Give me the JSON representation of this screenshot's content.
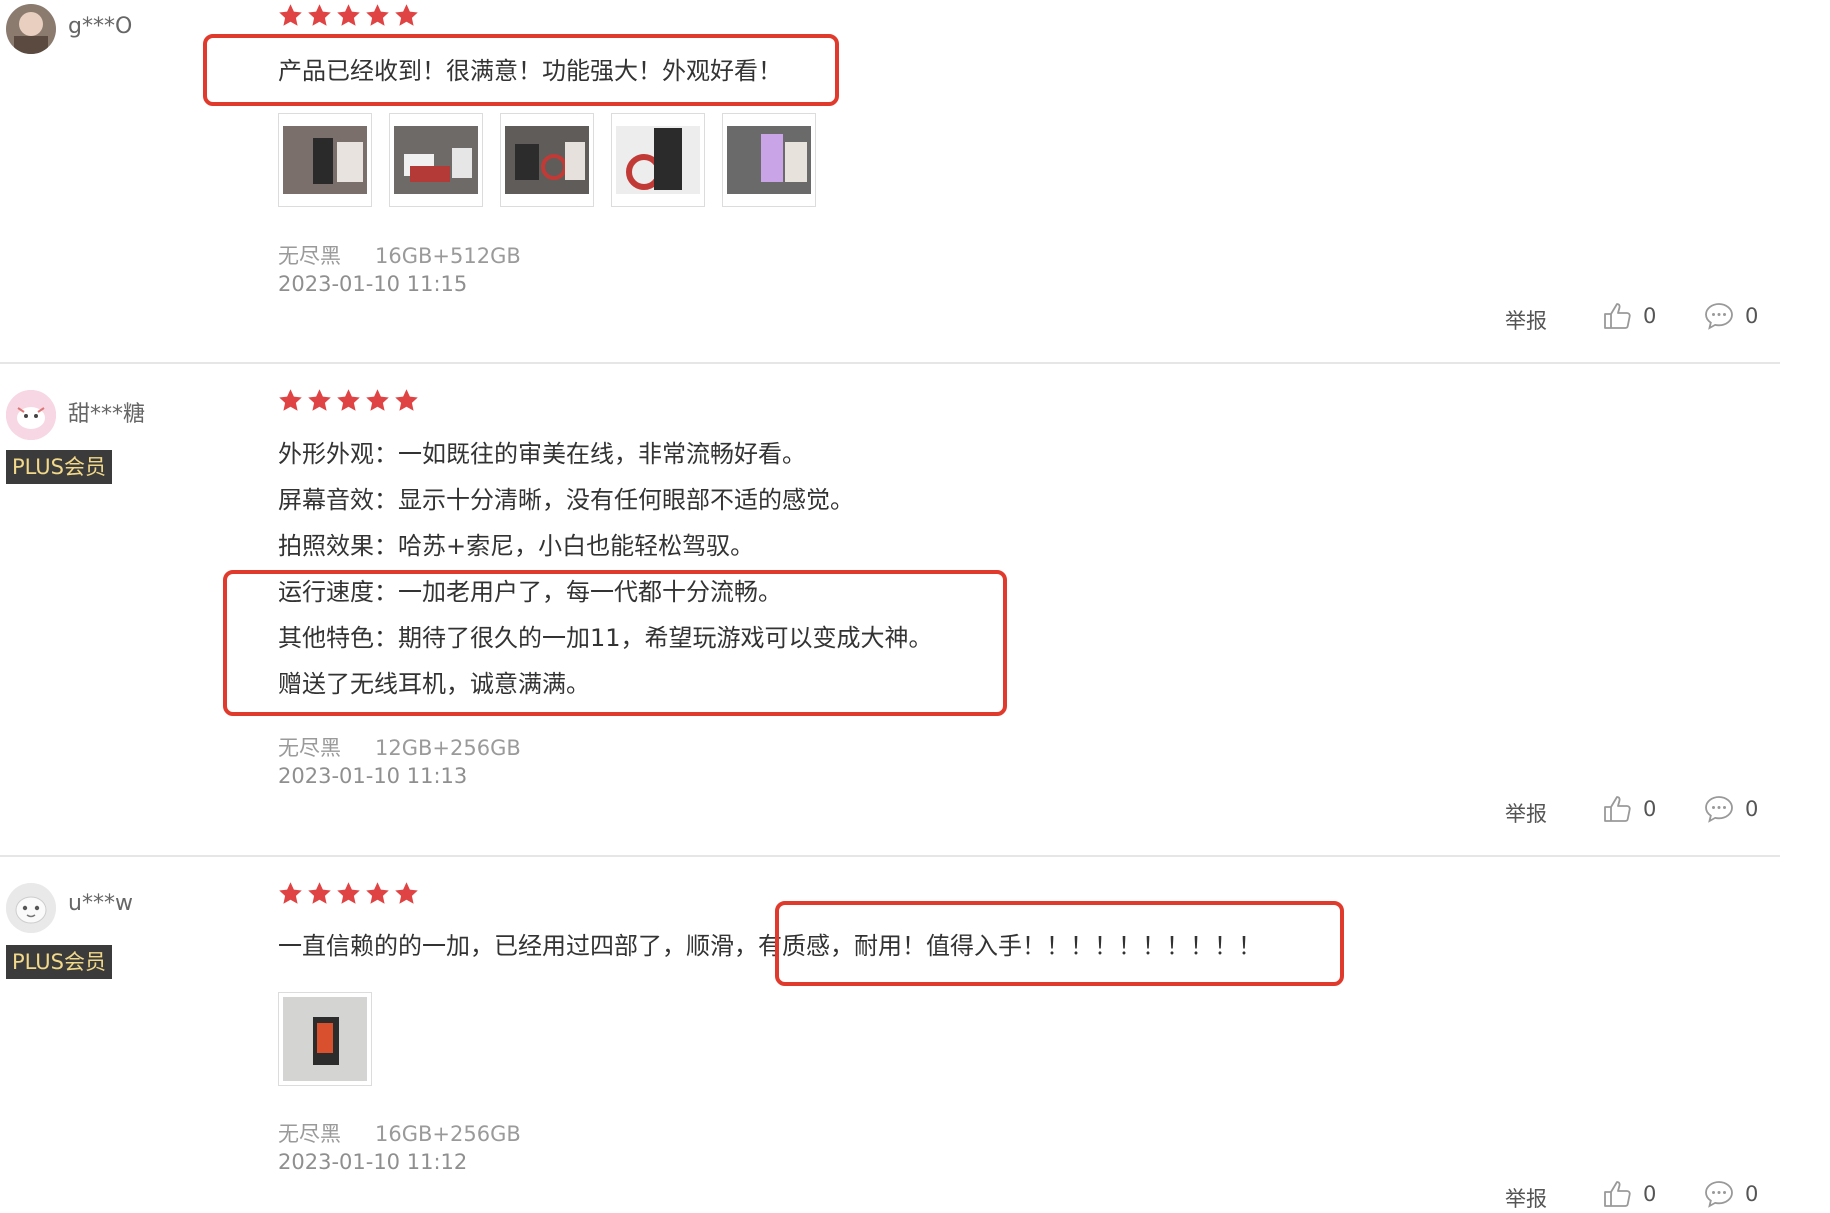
{
  "reviews": [
    {
      "username": "g***O",
      "plus_label": "",
      "stars": 5,
      "text_lines": [
        "产品已经收到！很满意！功能强大！外观好看！"
      ],
      "images": [
        "product-photo",
        "product-photo",
        "product-photo",
        "product-photo",
        "product-photo"
      ],
      "color": "无尽黑",
      "spec": "16GB+512GB",
      "date": "2023-01-10 11:15",
      "report_label": "举报",
      "likes": "0",
      "comments": "0"
    },
    {
      "username": "甜***糖",
      "plus_label": "PLUS会员",
      "stars": 5,
      "text_lines": [
        "外形外观：一如既往的审美在线，非常流畅好看。",
        "屏幕音效：显示十分清晰，没有任何眼部不适的感觉。",
        "拍照效果：哈苏+索尼，小白也能轻松驾驭。",
        "运行速度：一加老用户了，每一代都十分流畅。",
        "其他特色：期待了很久的一加11，希望玩游戏可以变成大神。",
        "赠送了无线耳机，诚意满满。"
      ],
      "images": [],
      "color": "无尽黑",
      "spec": "12GB+256GB",
      "date": "2023-01-10 11:13",
      "report_label": "举报",
      "likes": "0",
      "comments": "0"
    },
    {
      "username": "u***w",
      "plus_label": "PLUS会员",
      "stars": 5,
      "text_lines": [
        "一直信赖的的一加，已经用过四部了，顺滑，有质感，耐用！值得入手！！！！！！！！！！"
      ],
      "images": [
        "product-photo"
      ],
      "color": "无尽黑",
      "spec": "16GB+256GB",
      "date": "2023-01-10 11:12",
      "report_label": "举报",
      "likes": "0",
      "comments": "0"
    }
  ],
  "colors": {
    "star": "#e04343",
    "highlight": "#e03a2d",
    "plus_bg": "#3b3b3b",
    "plus_text": "#f2d98a"
  }
}
